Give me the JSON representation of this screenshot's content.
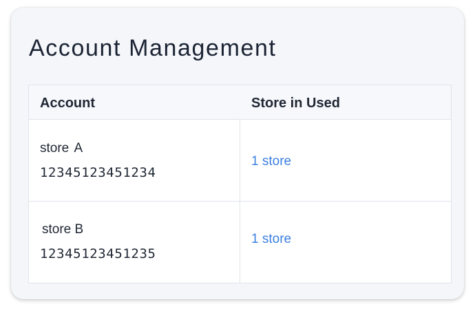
{
  "page": {
    "title": "Account Management"
  },
  "table": {
    "columns": [
      "Account",
      "Store in Used"
    ],
    "rows": [
      {
        "account_name": "store A",
        "account_id": "12345123451234",
        "stores_used": "1 store"
      },
      {
        "account_name": "store B",
        "account_id": "12345123451235",
        "stores_used": "1 store"
      }
    ]
  },
  "colors": {
    "link": "#3a7fe0",
    "card_background": "#f4f6fa",
    "border": "#dfe3ea"
  }
}
